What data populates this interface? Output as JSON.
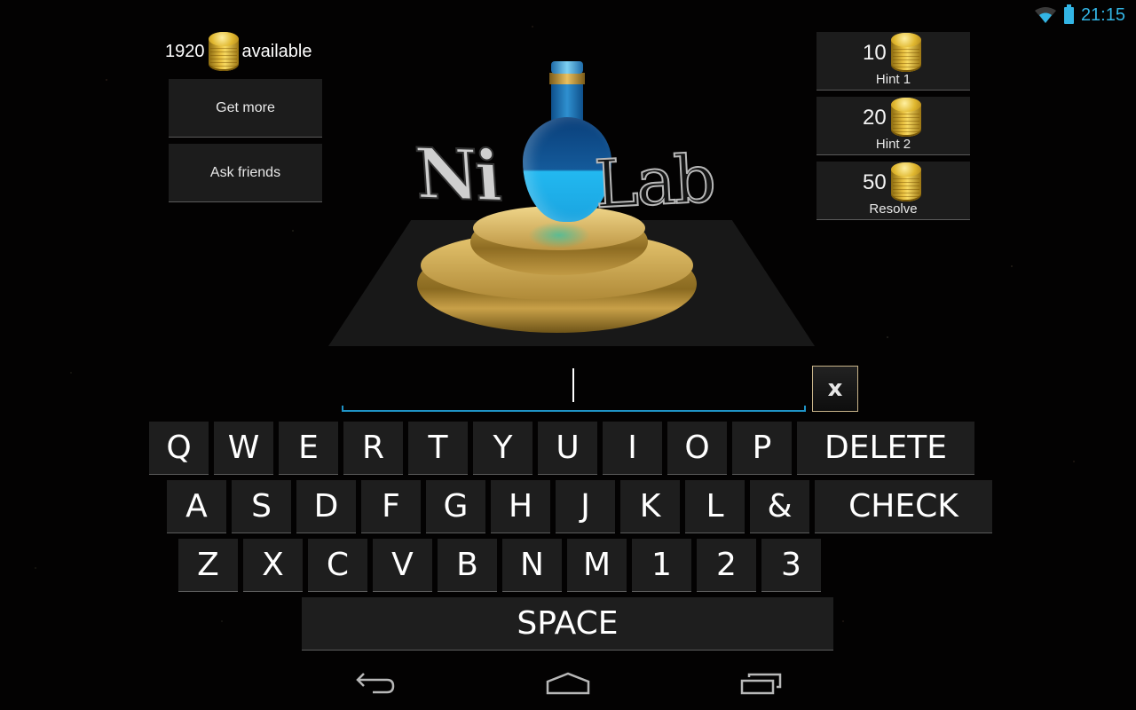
{
  "status_bar": {
    "time": "21:15",
    "icons": [
      "wifi-icon",
      "battery-icon"
    ],
    "accent_color": "#33b5e5"
  },
  "balance": {
    "amount": "1920",
    "label": "available",
    "icon": "coin-stack-icon"
  },
  "left_buttons": {
    "get_more": "Get more",
    "ask_friends": "Ask friends"
  },
  "hints": [
    {
      "cost": "10",
      "label": "Hint 1"
    },
    {
      "cost": "20",
      "label": "Hint 2"
    },
    {
      "cost": "50",
      "label": "Resolve"
    }
  ],
  "logo": {
    "left_text": "Ni",
    "right_text": "Lab"
  },
  "answer": {
    "value": "",
    "clear_label": "x",
    "underline_color": "#1f93c6"
  },
  "keyboard": {
    "row1": [
      "Q",
      "W",
      "E",
      "R",
      "T",
      "Y",
      "U",
      "I",
      "O",
      "P"
    ],
    "row1_action": "DELETE",
    "row2": [
      "A",
      "S",
      "D",
      "F",
      "G",
      "H",
      "J",
      "K",
      "L",
      "&"
    ],
    "row2_action": "CHECK",
    "row3": [
      "Z",
      "X",
      "C",
      "V",
      "B",
      "N",
      "M",
      "1",
      "2",
      "3"
    ],
    "space": "SPACE"
  },
  "nav_bar": {
    "icons": [
      "back-icon",
      "home-icon",
      "recent-apps-icon"
    ]
  }
}
